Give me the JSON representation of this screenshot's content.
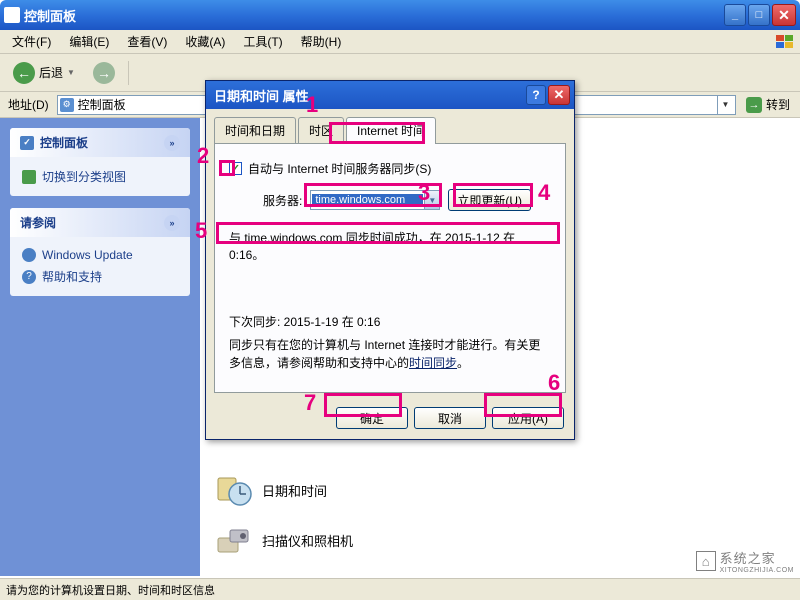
{
  "window": {
    "title": "控制面板",
    "btn_min": "_",
    "btn_max": "□",
    "btn_close": "✕"
  },
  "menubar": {
    "file": "文件(F)",
    "edit": "编辑(E)",
    "view": "查看(V)",
    "favorites": "收藏(A)",
    "tools": "工具(T)",
    "help": "帮助(H)"
  },
  "toolbar": {
    "back": "后退"
  },
  "addressbar": {
    "label": "地址(D)",
    "value": "控制面板",
    "go": "转到"
  },
  "sidebar": {
    "panel1_title": "控制面板",
    "panel1_link": "切换到分类视图",
    "panel2_title": "请参阅",
    "panel2_link1": "Windows Update",
    "panel2_link2": "帮助和支持"
  },
  "main": {
    "item1": "日期和时间",
    "item2": "扫描仪和照相机"
  },
  "dialog": {
    "title": "日期和时间 属性",
    "tab1": "时间和日期",
    "tab2": "时区",
    "tab3": "Internet 时间",
    "auto_sync": "自动与 Internet 时间服务器同步(S)",
    "server_label": "服务器:",
    "server_value": "time.windows.com",
    "update_now": "立即更新(U)",
    "status": "与 time.windows.com 同步时间成功，在 2015-1-12 在 0:16。",
    "next_sync": "下次同步:  2015-1-19 在 0:16",
    "note_pre": "同步只有在您的计算机与 Internet 连接时才能进行。有关更多信息，请参阅帮助和支持中心的",
    "note_link": "时间同步",
    "note_post": "。",
    "ok": "确定",
    "cancel": "取消",
    "apply": "应用(A)"
  },
  "statusbar": {
    "text": "请为您的计算机设置日期、时间和时区信息"
  },
  "callouts": {
    "c1": "1",
    "c2": "2",
    "c3": "3",
    "c4": "4",
    "c5": "5",
    "c6": "6",
    "c7": "7"
  },
  "watermark": "系统之家",
  "watermark_sub": "XITONGZHIJIA.COM"
}
